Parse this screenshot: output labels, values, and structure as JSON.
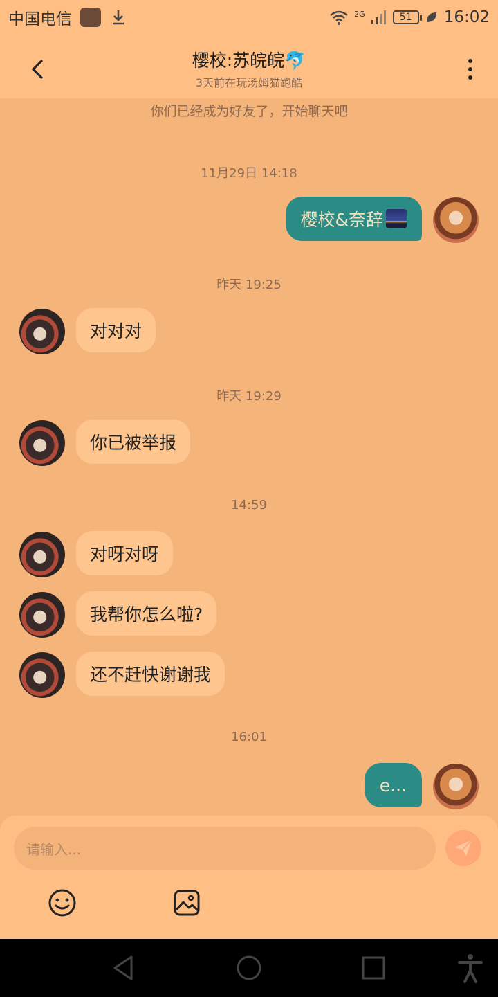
{
  "status_bar": {
    "carrier": "中国电信",
    "network": "2G",
    "battery": "51",
    "time": "16:02"
  },
  "header": {
    "title": "樱校:苏皖皖🐬",
    "subtitle": "3天前在玩汤姆猫跑酷"
  },
  "chat": {
    "notice": "你们已经成为好友了，开始聊天吧",
    "timestamps": [
      "11月29日 14:18",
      "昨天 19:25",
      "昨天 19:29",
      "14:59",
      "16:01"
    ],
    "messages": [
      {
        "direction": "out",
        "text": "樱校&奈辞"
      },
      {
        "direction": "in",
        "text": "对对对"
      },
      {
        "direction": "in",
        "text": "你已被举报"
      },
      {
        "direction": "in",
        "text": "对呀对呀"
      },
      {
        "direction": "in",
        "text": "我帮你怎么啦?"
      },
      {
        "direction": "in",
        "text": "还不赶快谢谢我"
      },
      {
        "direction": "out",
        "text": "e..."
      }
    ]
  },
  "composer": {
    "placeholder": "请输入..."
  },
  "icons": {
    "back": "chevron-left-icon",
    "more": "more-vertical-icon",
    "send": "paper-plane-icon",
    "emoji": "smiley-icon",
    "image": "image-icon"
  },
  "colors": {
    "background": "#f5b47a",
    "header": "#ffbf84",
    "outgoing_bubble": "#2a8c84",
    "incoming_bubble": "#ffc58f",
    "send_button": "#ffa877"
  }
}
